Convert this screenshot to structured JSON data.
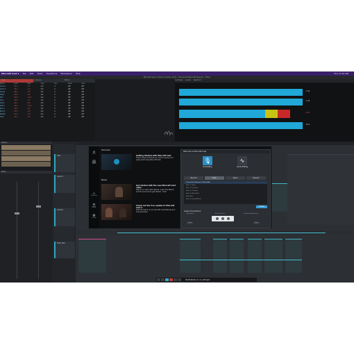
{
  "menubar": {
    "app": "Mixcraft Cast 1",
    "items": [
      "File",
      "Edit",
      "Track",
      "Transitions",
      "Workspace",
      "Help"
    ],
    "right": "Thu 11:52 AM"
  },
  "window_title": "Mixcraft Cast 1 (Track & Gizmo.vbm) • Podcast Default Workspace • Mixer",
  "mix_table": {
    "tabs": [
      "Mixer",
      "Loudness",
      "Meters"
    ],
    "columns": [
      "Name",
      "Level",
      "Peak",
      "Gain",
      "Pan",
      "Mute",
      "Solo"
    ],
    "rows": [
      {
        "name": "Voice 1",
        "level": "-14.2",
        "peak": "-3.1",
        "gain": "0.0",
        "pan": "C",
        "mute": "Off",
        "solo": "Off"
      },
      {
        "name": "Voice 2",
        "level": "-16.7",
        "peak": "-4.4",
        "gain": "0.0",
        "pan": "C",
        "mute": "Off",
        "solo": "Off"
      },
      {
        "name": "Guest",
        "level": "-18.3",
        "peak": "-5.9",
        "gain": "0.0",
        "pan": "C",
        "mute": "Off",
        "solo": "Off"
      },
      {
        "name": "Music",
        "level": "-22.0",
        "peak": "-9.2",
        "gain": "0.0",
        "pan": "C",
        "mute": "Off",
        "solo": "Off"
      },
      {
        "name": "SFX",
        "level": "-24.8",
        "peak": "-11.0",
        "gain": "0.0",
        "pan": "C",
        "mute": "Off",
        "solo": "Off"
      },
      {
        "name": "Intro",
        "level": "-19.5",
        "peak": "-7.7",
        "gain": "0.0",
        "pan": "C",
        "mute": "Off",
        "solo": "Off"
      },
      {
        "name": "Outro",
        "level": "-20.1",
        "peak": "-8.0",
        "gain": "0.0",
        "pan": "C",
        "mute": "Off",
        "solo": "Off"
      },
      {
        "name": "Room",
        "level": "-30.4",
        "peak": "-15.6",
        "gain": "0.0",
        "pan": "C",
        "mute": "Off",
        "solo": "Off"
      },
      {
        "name": "Bus A",
        "level": "-12.9",
        "peak": "-2.5",
        "gain": "0.0",
        "pan": "C",
        "mute": "Off",
        "solo": "Off"
      },
      {
        "name": "Bus B",
        "level": "-13.4",
        "peak": "-2.9",
        "gain": "0.0",
        "pan": "C",
        "mute": "Off",
        "solo": "Off"
      },
      {
        "name": "Master",
        "level": "-11.0",
        "peak": "-1.8",
        "gain": "0.0",
        "pan": "C",
        "mute": "Off",
        "solo": "Off"
      },
      {
        "name": "Total",
        "level": "-11.0",
        "peak": "-1.8",
        "gain": "0.0",
        "pan": "C",
        "mute": "Off",
        "solo": "Off"
      }
    ]
  },
  "meters": {
    "tabs": [
      "Loudness",
      "Levels",
      "Spectrum"
    ],
    "values": [
      {
        "label": "L",
        "value": "-7.44"
      },
      {
        "label": "R",
        "value": "-7.44"
      },
      {
        "label": "M",
        "value": "-9.12"
      },
      {
        "label": "S",
        "value": "-9.12"
      }
    ],
    "colors": {
      "cyan": "#1fa8d8",
      "yellow": "#c8c214",
      "red": "#c82828"
    }
  },
  "left_panel": {
    "header": "Library",
    "tabs": [
      "Sounds",
      "Mixer"
    ]
  },
  "track_headers": [
    {
      "name": "Host"
    },
    {
      "name": "Guest 1"
    },
    {
      "name": "Guest 2"
    },
    {
      "name": "Music Bed"
    }
  ],
  "welcome": {
    "sidebar": [
      "Home",
      "Tutorials",
      "Podcasting",
      "Audio Editing",
      "Settings"
    ],
    "tutorials_title": "Tutorials",
    "news_title": "News",
    "tutorial_item": {
      "title": "Getting Started with Mixcraft Cast",
      "body": "These videos will show you how to quickly and easily start using Mixcraft Cast."
    },
    "news_items": [
      {
        "title": "Get started with the new Mixcraft Cast video",
        "body": "Watch our new video tutorial, 'Learn the Basics' and find out how to get started – fast!"
      },
      {
        "title": "Check out the free update to Mixcraft Cast 2",
        "body": "Mixcraft Cast 2 is out now with new features and improvements."
      }
    ]
  },
  "dialog": {
    "title": "Welcome to Mixcraft Cast",
    "modes": [
      {
        "label": "Podcasting",
        "color": "#2a8fc4"
      },
      {
        "label": "Audio Editing",
        "color": "#3a3e44"
      }
    ],
    "buttons": [
      "Record",
      "New",
      "Open",
      "Recent"
    ],
    "list": [
      "Create New Podcast (2 Hosts/Mix)",
      "Host + Guest",
      "Host + 2 Guests",
      "Host + 3 Guests",
      "Host + Music Bed",
      "Solo Host",
      "Host + Sound Effects"
    ],
    "create_label": "Create",
    "connections_title": "Audio Connections",
    "connection_cols": [
      "Microphone",
      "Audio Interface",
      "Speakers/Headphones"
    ],
    "small_buttons": [
      "Select",
      "Select"
    ]
  },
  "transport": {
    "timecode": "00:00:00.00 | 4 / 4 | 120 bpm"
  }
}
